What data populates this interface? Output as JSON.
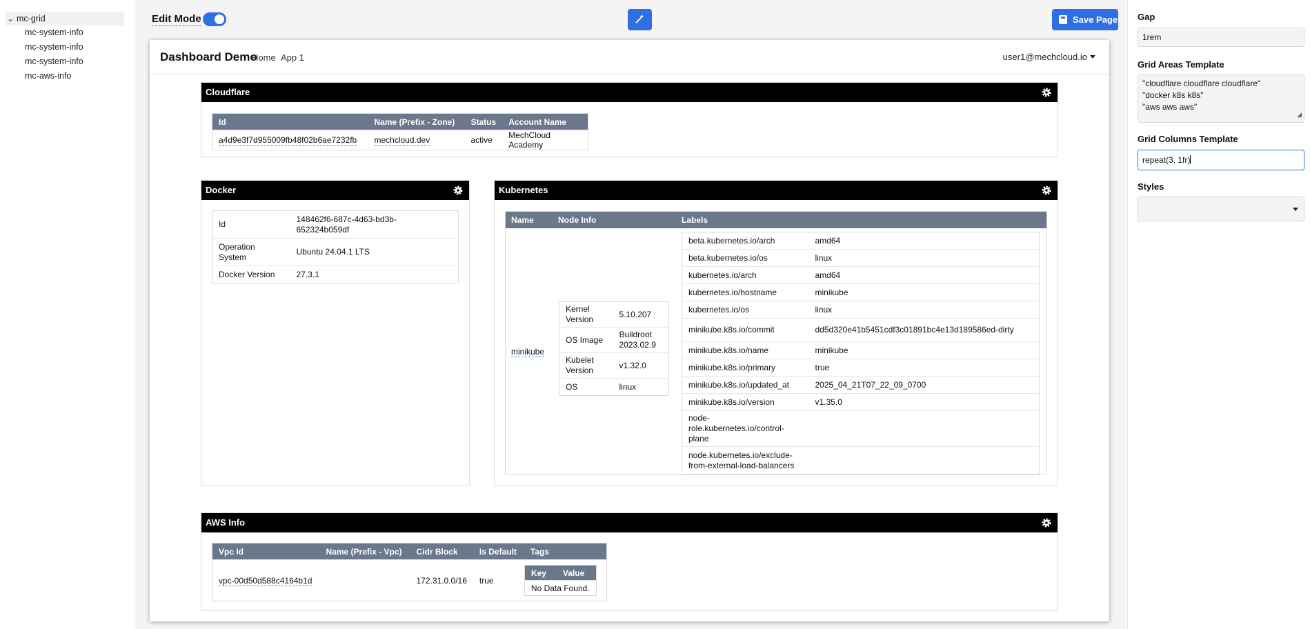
{
  "tree": {
    "root": "mc-grid",
    "children": [
      "mc-system-info",
      "mc-system-info",
      "mc-system-info",
      "mc-aws-info"
    ]
  },
  "toolbar": {
    "edit_mode_label": "Edit Mode",
    "edit_mode_on": true,
    "save_label": "Save Page"
  },
  "nav": {
    "brand": "Dashboard Demo",
    "links": [
      "Home",
      "App 1"
    ],
    "user": "user1@mechcloud.io"
  },
  "cloudflare": {
    "title": "Cloudflare",
    "columns": [
      "Id",
      "Name (Prefix - Zone)",
      "Status",
      "Account Name"
    ],
    "rows": [
      [
        "a4d9e3f7d955009fb48f02b6ae7232fb",
        "mechcloud.dev",
        "active",
        "MechCloud Academy"
      ]
    ]
  },
  "docker": {
    "title": "Docker",
    "rows": [
      {
        "key": "Id",
        "value": "148462f6-687c-4d63-bd3b-652324b059df"
      },
      {
        "key": "Operation System",
        "value": "Ubuntu 24.04.1 LTS"
      },
      {
        "key": "Docker Version",
        "value": "27.3.1"
      }
    ]
  },
  "kubernetes": {
    "title": "Kubernetes",
    "columns": [
      "Name",
      "Node Info",
      "Labels"
    ],
    "name": "minikube",
    "node_info": [
      {
        "key": "Kernel Version",
        "value": "5.10.207"
      },
      {
        "key": "OS Image",
        "value": "Buildroot 2023.02.9"
      },
      {
        "key": "Kubelet Version",
        "value": "v1.32.0"
      },
      {
        "key": "OS",
        "value": "linux"
      }
    ],
    "labels": [
      {
        "key": "beta.kubernetes.io/arch",
        "value": "amd64"
      },
      {
        "key": "beta.kubernetes.io/os",
        "value": "linux"
      },
      {
        "key": "kubernetes.io/arch",
        "value": "amd64"
      },
      {
        "key": "kubernetes.io/hostname",
        "value": "minikube"
      },
      {
        "key": "kubernetes.io/os",
        "value": "linux"
      },
      {
        "key": "minikube.k8s.io/commit",
        "value": "dd5d320e41b5451cdf3c01891bc4e13d189586ed-dirty"
      },
      {
        "key": "minikube.k8s.io/name",
        "value": "minikube"
      },
      {
        "key": "minikube.k8s.io/primary",
        "value": "true"
      },
      {
        "key": "minikube.k8s.io/updated_at",
        "value": "2025_04_21T07_22_09_0700"
      },
      {
        "key": "minikube.k8s.io/version",
        "value": "v1.35.0"
      },
      {
        "key": "node-role.kubernetes.io/control-plane",
        "value": ""
      },
      {
        "key": "node.kubernetes.io/exclude-from-external-load-balancers",
        "value": ""
      }
    ]
  },
  "aws": {
    "title": "AWS Info",
    "columns": [
      "Vpc Id",
      "Name (Prefix - Vpc)",
      "Cidr Block",
      "Is Default",
      "Tags"
    ],
    "row": {
      "vpc_id": "vpc-00d50d588c4164b1d",
      "name": "",
      "cidr": "172.31.0.0/16",
      "is_default": "true"
    },
    "tags_columns": [
      "Key",
      "Value"
    ],
    "tags_empty": "No Data Found."
  },
  "props": {
    "gap_label": "Gap",
    "gap_value": "1rem",
    "areas_label": "Grid Areas Template",
    "areas_value": [
      "\"cloudflare cloudflare cloudflare\"",
      "\"docker k8s k8s\"",
      "\"aws aws aws\""
    ],
    "columns_label": "Grid Columns Template",
    "columns_value": "repeat(3, 1fr)",
    "styles_label": "Styles",
    "styles_value": ""
  },
  "colors": {
    "accent": "#2f6fe4",
    "table_header": "#6b778b",
    "card_header": "#000000"
  },
  "icons": [
    "chevron-down-icon",
    "magic-wand-icon",
    "save-icon",
    "gear-icon",
    "caret-down-icon"
  ]
}
